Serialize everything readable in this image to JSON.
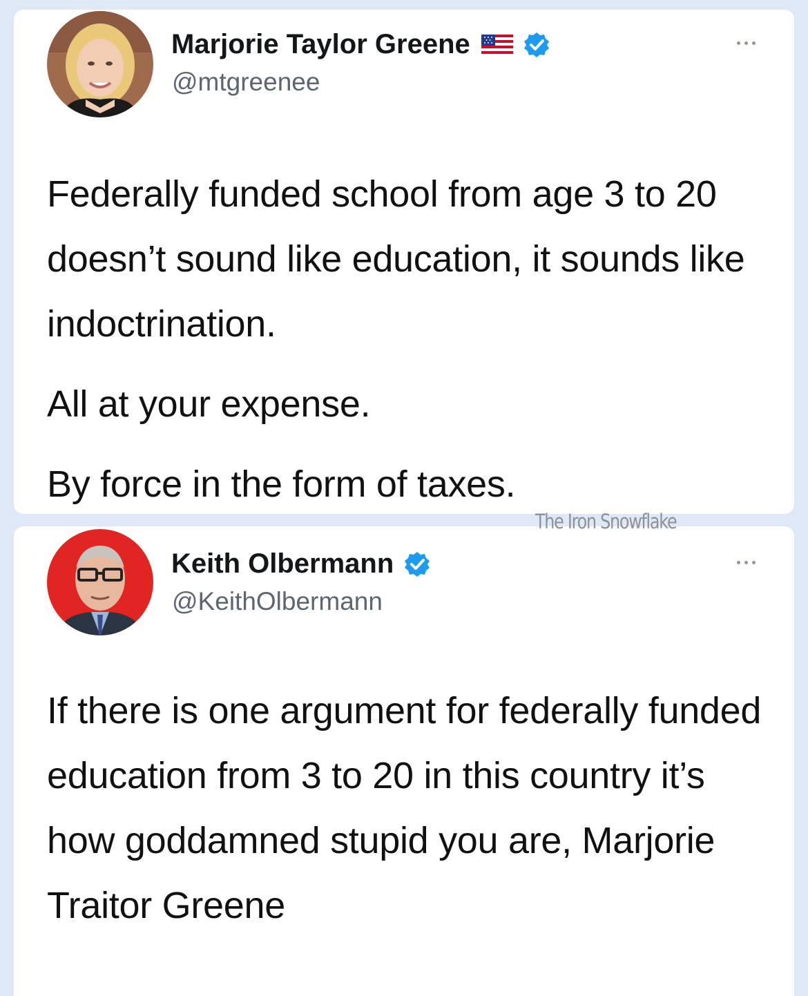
{
  "tweets": [
    {
      "name": "Marjorie Taylor Greene",
      "handle": "@mtgreenee",
      "verified": true,
      "flag": "us-flag",
      "avatar_icon": "woman-portrait",
      "text_lines": [
        "Federally funded school from age 3 to 20 doesn’t sound like education, it sounds like indoctrination.",
        "All at your expense.",
        "By force in the form of taxes."
      ]
    },
    {
      "name": "Keith Olbermann",
      "handle": "@KeithOlbermann",
      "verified": true,
      "avatar_icon": "man-portrait",
      "text_lines": [
        "If there is one argument for federally funded education from 3 to 20 in this country it’s how goddamned stupid you are, Marjorie Traitor Greene"
      ]
    }
  ],
  "watermark": "The Iron Snowflake",
  "colors": {
    "background": "#dfe8f7",
    "card": "#ffffff",
    "verified_blue": "#1d9bf0",
    "handle_gray": "#5b6670"
  }
}
